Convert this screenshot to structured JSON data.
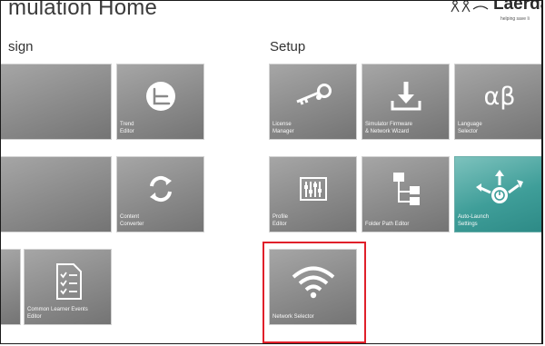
{
  "header": {
    "title": "mulation Home",
    "logo_text": "Laerda",
    "logo_tagline": "helping save li"
  },
  "sections": {
    "design": "sign",
    "setup": "Setup"
  },
  "tiles": {
    "design_1": "",
    "trend_editor": "Trend\nEditor",
    "design_2": "",
    "content_converter": "Content\nConverter",
    "design_3": "",
    "common_learner_events": "Common Learner Events\nEditor",
    "license_manager": "License\nManager",
    "simulator_firmware": "Simulator Firmware\n& Network Wizard",
    "language_selector": "Language\nSelector",
    "profile_editor": "Profile\nEditor",
    "folder_path_editor": "Folder Path Editor",
    "auto_launch": "Auto-Launch\nSettings",
    "network_selector": "Network Selector"
  },
  "icons": {
    "language_glyph": "αβ"
  },
  "colors": {
    "tile_gray": "#8a8a8a",
    "tile_teal": "#3f9e99",
    "highlight": "#e0202a"
  }
}
